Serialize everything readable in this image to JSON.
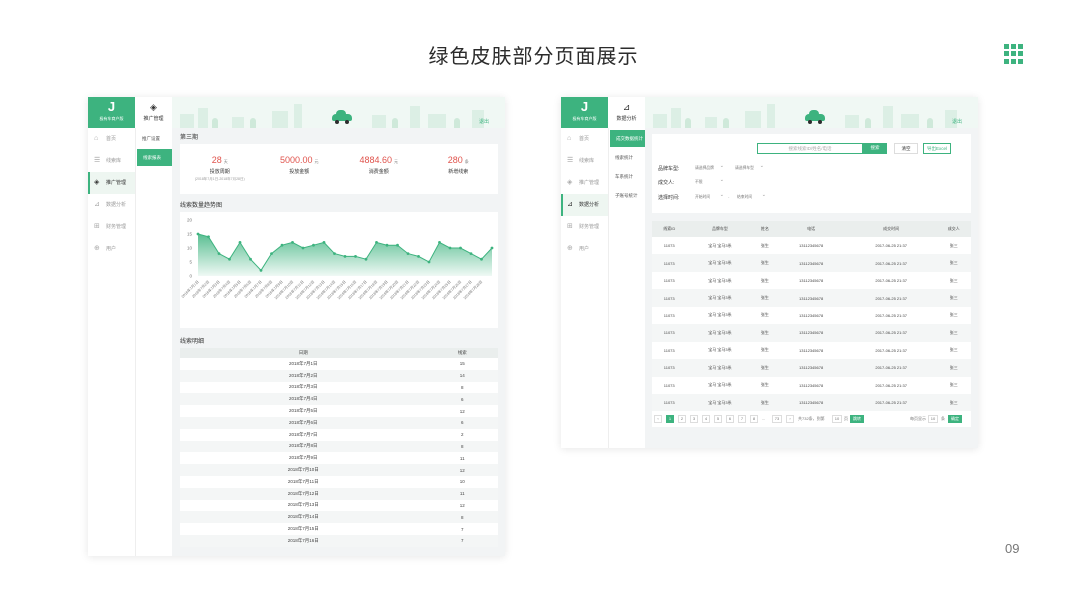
{
  "page": {
    "title": "绿色皮肤部分页面展示",
    "page_number": "09",
    "accent": "#3db37f"
  },
  "brand": {
    "logo_letter": "J",
    "name": "极有车商户版"
  },
  "panel1": {
    "top_nav": {
      "icon": "tag-icon",
      "label": "推广管理"
    },
    "logout": "退出",
    "sidebar": [
      {
        "label": "首页",
        "icon": "home-icon",
        "active": false
      },
      {
        "label": "线索库",
        "icon": "list-icon",
        "active": false
      },
      {
        "label": "推广管理",
        "icon": "tag-icon",
        "active": true
      },
      {
        "label": "数据分析",
        "icon": "chart-icon",
        "active": false
      },
      {
        "label": "财务管理",
        "icon": "finance-icon",
        "active": false
      },
      {
        "label": "用户",
        "icon": "user-icon",
        "active": false
      }
    ],
    "subnav": [
      {
        "label": "推广设置",
        "active": false
      },
      {
        "label": "线索报表",
        "active": true
      }
    ],
    "period_title": "第三期",
    "stats": [
      {
        "value": "28",
        "unit": "天",
        "label": "投放周期",
        "sub": "(2018年7月1日-2018年7月28日)"
      },
      {
        "value": "5000.00",
        "unit": "元",
        "label": "投放金额",
        "sub": ""
      },
      {
        "value": "4884.60",
        "unit": "元",
        "label": "消费金额",
        "sub": ""
      },
      {
        "value": "280",
        "unit": "条",
        "label": "新增线索",
        "sub": ""
      }
    ],
    "chart_title": "线索数量趋势图",
    "detail_title": "线索明细",
    "detail_headers": [
      "日期",
      "线索"
    ],
    "detail_rows": [
      [
        "2018年7月1日",
        "15"
      ],
      [
        "2018年7月2日",
        "14"
      ],
      [
        "2018年7月3日",
        "8"
      ],
      [
        "2018年7月4日",
        "6"
      ],
      [
        "2018年7月5日",
        "12"
      ],
      [
        "2018年7月6日",
        "6"
      ],
      [
        "2018年7月7日",
        "2"
      ],
      [
        "2018年7月8日",
        "8"
      ],
      [
        "2018年7月9日",
        "11"
      ],
      [
        "2018年7月10日",
        "12"
      ],
      [
        "2018年7月11日",
        "10"
      ],
      [
        "2018年7月12日",
        "11"
      ],
      [
        "2018年7月13日",
        "12"
      ],
      [
        "2018年7月14日",
        "8"
      ],
      [
        "2018年7月15日",
        "7"
      ],
      [
        "2018年7月16日",
        "7"
      ]
    ]
  },
  "chart_data": {
    "type": "area",
    "title": "线索数量趋势图",
    "xlabel": "",
    "ylabel": "",
    "ylim": [
      0,
      20
    ],
    "yticks": [
      0,
      5,
      10,
      15,
      20
    ],
    "x": [
      "2018年7月1日",
      "2018年7月2日",
      "2018年7月3日",
      "2018年7月4日",
      "2018年7月5日",
      "2018年7月6日",
      "2018年7月7日",
      "2018年7月8日",
      "2018年7月9日",
      "2018年7月10日",
      "2018年7月11日",
      "2018年7月12日",
      "2018年7月13日",
      "2018年7月14日",
      "2018年7月15日",
      "2018年7月16日",
      "2018年7月17日",
      "2018年7月18日",
      "2018年7月19日",
      "2018年7月20日",
      "2018年7月21日",
      "2018年7月22日",
      "2018年7月23日",
      "2018年7月24日",
      "2018年7月25日",
      "2018年7月26日",
      "2018年7月27日",
      "2018年7月28日"
    ],
    "values": [
      15,
      14,
      8,
      6,
      12,
      6,
      2,
      8,
      11,
      12,
      10,
      11,
      12,
      8,
      7,
      7,
      6,
      12,
      11,
      11,
      8,
      7,
      5,
      12,
      10,
      10,
      8,
      6,
      10
    ],
    "grid": false,
    "color": "#3db37f"
  },
  "panel2": {
    "top_nav": {
      "icon": "chart-icon",
      "label": "数据分析"
    },
    "logout": "退出",
    "sidebar": [
      {
        "label": "首页",
        "icon": "home-icon",
        "active": false
      },
      {
        "label": "线索库",
        "icon": "list-icon",
        "active": false
      },
      {
        "label": "推广管理",
        "icon": "tag-icon",
        "active": false
      },
      {
        "label": "数据分析",
        "icon": "chart-icon",
        "active": true
      },
      {
        "label": "财务管理",
        "icon": "finance-icon",
        "active": false
      },
      {
        "label": "用户",
        "icon": "user-icon",
        "active": false
      }
    ],
    "subnav": [
      {
        "label": "成交数据统计",
        "active": true
      },
      {
        "label": "线索统计",
        "active": false
      },
      {
        "label": "车系统计",
        "active": false
      },
      {
        "label": "子账号统计",
        "active": false
      }
    ],
    "search_placeholder": "搜索线索ID/姓名/电话",
    "search_btn": "搜索",
    "clear_btn": "清空",
    "export_btn": "导出Excel",
    "filters": {
      "brand_label": "品牌车型:",
      "brand_placeholder": "请选择品牌",
      "model_placeholder": "请选择车型",
      "dealer_label": "成交人:",
      "dealer_value": "不限",
      "time_label": "选择时间:",
      "start_placeholder": "开始时间",
      "range_sep": "-",
      "end_placeholder": "结束时间"
    },
    "table_headers": [
      "线索ID",
      "品牌车型",
      "姓名",
      "电话",
      "成交时间",
      "成交人"
    ],
    "table_rows": [
      [
        "11073",
        "宝马 宝马3系",
        "张生",
        "13112345678",
        "2017-06-25 21:37",
        "张三"
      ],
      [
        "11073",
        "宝马 宝马3系",
        "张生",
        "13112345678",
        "2017-06-25 21:37",
        "张三"
      ],
      [
        "11073",
        "宝马 宝马3系",
        "张生",
        "13112345678",
        "2017-06-25 21:37",
        "张三"
      ],
      [
        "11073",
        "宝马 宝马3系",
        "张生",
        "13112345678",
        "2017-06-25 21:37",
        "张三"
      ],
      [
        "11073",
        "宝马 宝马3系",
        "张生",
        "13112345678",
        "2017-06-25 21:37",
        "张三"
      ],
      [
        "11073",
        "宝马 宝马3系",
        "张生",
        "13112345678",
        "2017-06-25 21:37",
        "张三"
      ],
      [
        "11073",
        "宝马 宝马3系",
        "张生",
        "13112345678",
        "2017-06-25 21:37",
        "张三"
      ],
      [
        "11073",
        "宝马 宝马3系",
        "张生",
        "13112345678",
        "2017-06-25 21:37",
        "张三"
      ],
      [
        "11073",
        "宝马 宝马3系",
        "张生",
        "13112345678",
        "2017-06-25 21:37",
        "张三"
      ],
      [
        "11073",
        "宝马 宝马3系",
        "张生",
        "13112345678",
        "2017-06-25 21:37",
        "张三"
      ]
    ],
    "pager": {
      "prev": "‹",
      "pages": [
        "1",
        "2",
        "3",
        "4",
        "5",
        "6",
        "7",
        "8"
      ],
      "ellipsis": "...",
      "last": "73",
      "next": "›",
      "total_text": "共732条，到第",
      "goto_value": "10",
      "goto_suffix": "页",
      "goto_btn": "跳转",
      "per_page_label": "每页显示",
      "per_page_value": "10",
      "per_page_unit": "条",
      "confirm_btn": "确定"
    }
  }
}
